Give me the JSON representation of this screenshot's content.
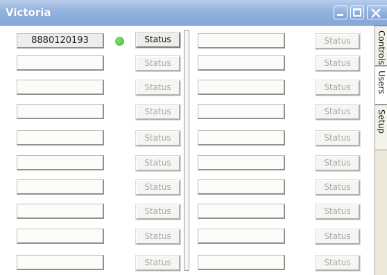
{
  "window": {
    "title": "Victoria"
  },
  "tabs": [
    {
      "label": "Controls"
    },
    {
      "label": "Users"
    },
    {
      "label": "Setup"
    }
  ],
  "left_column": [
    {
      "value": "8880120193",
      "status": "Status",
      "online": true,
      "enabled": true
    },
    {
      "value": "",
      "status": "Status",
      "enabled": false
    },
    {
      "value": "",
      "status": "Status",
      "enabled": false
    },
    {
      "value": "",
      "status": "Status",
      "enabled": false
    },
    {
      "value": "",
      "status": "Status",
      "enabled": false
    },
    {
      "value": "",
      "status": "Status",
      "enabled": false
    },
    {
      "value": "",
      "status": "Status",
      "enabled": false
    },
    {
      "value": "",
      "status": "Status",
      "enabled": false
    },
    {
      "value": "",
      "status": "Status",
      "enabled": false
    },
    {
      "value": "",
      "status": "Status",
      "enabled": false
    }
  ],
  "right_column": [
    {
      "value": "",
      "status": "Status",
      "enabled": false
    },
    {
      "value": "",
      "status": "Status",
      "enabled": false
    },
    {
      "value": "",
      "status": "Status",
      "enabled": false
    },
    {
      "value": "",
      "status": "Status",
      "enabled": false
    },
    {
      "value": "",
      "status": "Status",
      "enabled": false
    },
    {
      "value": "",
      "status": "Status",
      "enabled": false
    },
    {
      "value": "",
      "status": "Status",
      "enabled": false
    },
    {
      "value": "",
      "status": "Status",
      "enabled": false
    },
    {
      "value": "",
      "status": "Status",
      "enabled": false
    },
    {
      "value": "",
      "status": "Status",
      "enabled": false
    }
  ],
  "colors": {
    "online_indicator": "#45b63a",
    "titlebar": "#93b2de"
  }
}
